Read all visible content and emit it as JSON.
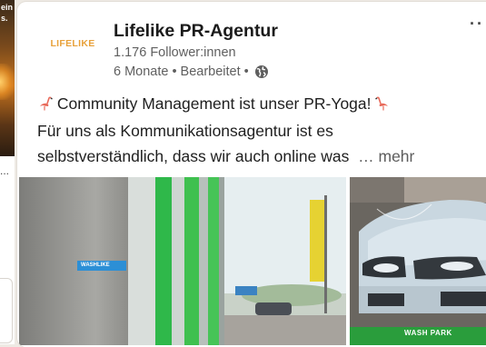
{
  "previous_post": {
    "overlay_text": "ein\ns.",
    "ellipsis": "..."
  },
  "post": {
    "author": {
      "name": "Lifelike PR-Agentur",
      "followers": "1.176 Follower:innen",
      "logo_text_main": "LIFELIKE",
      "time": "6 Monate",
      "separator": "•",
      "edited": "Bearbeitet",
      "visibility_icon": "globe-icon"
    },
    "menu_label": "··",
    "text": {
      "line1": "Community Management ist unser PR-Yoga!",
      "line2": "Für uns als Kommunikationsagentur ist es",
      "line3": "selbstverständlich, dass wir auch online was",
      "see_more_prefix": "…",
      "see_more": "mehr"
    },
    "images": {
      "left": {
        "sign_text": "WASHLIKE"
      },
      "right": {
        "brand_text": "WASH PARK"
      }
    }
  },
  "colors": {
    "logo_orange": "#e8a13a",
    "logo_green": "#b7c94a",
    "wall_green": "#3fbf4a",
    "background": "#eeeae4"
  }
}
